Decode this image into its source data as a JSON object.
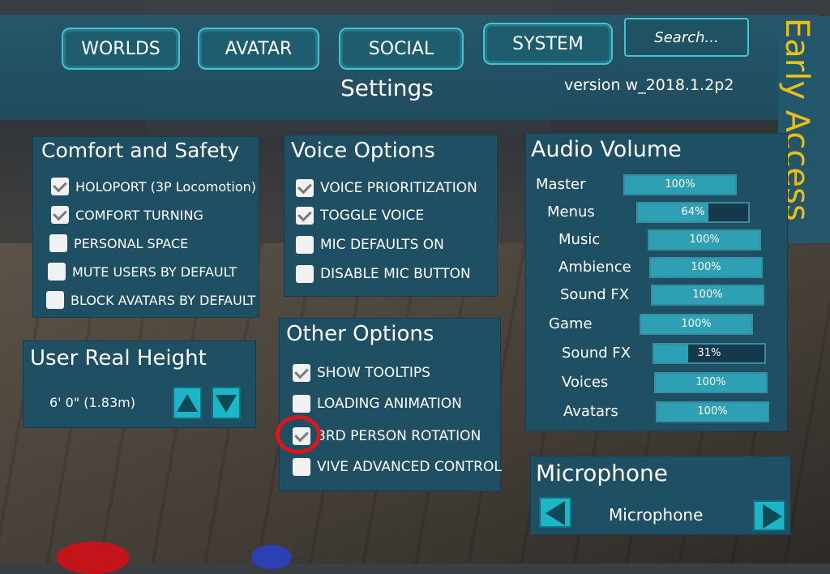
{
  "nav": {
    "buttons": [
      "WORLDS",
      "AVATAR",
      "SOCIAL",
      "SYSTEM"
    ],
    "search_placeholder": "Search..."
  },
  "header": {
    "title": "Settings",
    "version": "version w_2018.1.2p2",
    "badge": "Early Access"
  },
  "comfort": {
    "title": "Comfort and Safety",
    "items": [
      {
        "label": "HOLOPORT (3P Locomotion)",
        "checked": true
      },
      {
        "label": "COMFORT TURNING",
        "checked": true
      },
      {
        "label": "PERSONAL SPACE",
        "checked": false
      },
      {
        "label": "MUTE USERS BY DEFAULT",
        "checked": false
      },
      {
        "label": "BLOCK AVATARS BY DEFAULT",
        "checked": false
      }
    ]
  },
  "height": {
    "title": "User Real Height",
    "value": "6' 0\" (1.83m)"
  },
  "voice": {
    "title": "Voice Options",
    "items": [
      {
        "label": "VOICE PRIORITIZATION",
        "checked": true
      },
      {
        "label": "TOGGLE VOICE",
        "checked": true
      },
      {
        "label": "MIC DEFAULTS ON",
        "checked": false
      },
      {
        "label": "DISABLE MIC BUTTON",
        "checked": false
      }
    ]
  },
  "other": {
    "title": "Other Options",
    "items": [
      {
        "label": "SHOW TOOLTIPS",
        "checked": true
      },
      {
        "label": "LOADING ANIMATION",
        "checked": false
      },
      {
        "label": "3RD PERSON ROTATION",
        "checked": true
      },
      {
        "label": "VIVE ADVANCED CONTROL",
        "checked": false
      }
    ]
  },
  "audio": {
    "title": "Audio Volume",
    "rows": [
      {
        "label": "Master",
        "value": "100%",
        "level": 1.0
      },
      {
        "label": "Menus",
        "value": "64%",
        "level": 0.64
      },
      {
        "label": "Music",
        "value": "100%",
        "level": 1.0
      },
      {
        "label": "Ambience",
        "value": "100%",
        "level": 1.0
      },
      {
        "label": "Sound FX",
        "value": "100%",
        "level": 1.0
      },
      {
        "label": "Game",
        "value": "100%",
        "level": 1.0
      },
      {
        "label": "Sound FX",
        "value": "31%",
        "level": 0.31
      },
      {
        "label": "Voices",
        "value": "100%",
        "level": 1.0
      },
      {
        "label": "Avatars",
        "value": "100%",
        "level": 1.0
      }
    ]
  },
  "microphone": {
    "title": "Microphone",
    "selected": "Microphone"
  },
  "colors": {
    "accent": "#3fc4d4",
    "panel": "#1e4f62",
    "badge": "#f5c518",
    "highlight_ring": "#e0151b"
  }
}
